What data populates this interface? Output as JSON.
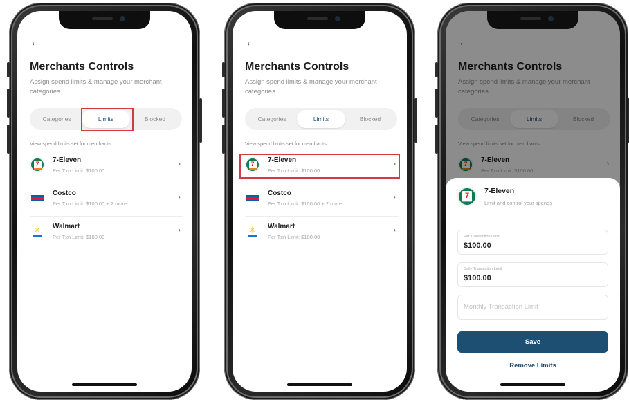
{
  "screens": [
    {
      "title": "Merchants Controls",
      "subtitle": "Assign spend limits & manage your merchant categories",
      "tabs": [
        "Categories",
        "Limits",
        "Blocked"
      ],
      "active_tab": "Limits",
      "highlight": "Limits tab",
      "list_caption": "View spend limits set for merchants",
      "merchants": [
        {
          "name": "7-Eleven",
          "limit": "Per Txn Limit: $100.00",
          "logo": "7-eleven-logo"
        },
        {
          "name": "Costco",
          "limit": "Per Txn Limit: $100.00 + 2 more",
          "logo": "costco-logo"
        },
        {
          "name": "Walmart",
          "limit": "Per Txn Limit: $100.00",
          "logo": "walmart-logo"
        }
      ]
    },
    {
      "title": "Merchants Controls",
      "subtitle": "Assign spend limits & manage your merchant categories",
      "tabs": [
        "Categories",
        "Limits",
        "Blocked"
      ],
      "active_tab": "Limits",
      "highlight": "7-Eleven row",
      "list_caption": "View spend limits set for merchants",
      "merchants": [
        {
          "name": "7-Eleven",
          "limit": "Per Txn Limit: $100.00",
          "logo": "7-eleven-logo"
        },
        {
          "name": "Costco",
          "limit": "Per Txn Limit: $100.00 + 2 more",
          "logo": "costco-logo"
        },
        {
          "name": "Walmart",
          "limit": "Per Txn Limit: $100.00",
          "logo": "walmart-logo"
        }
      ]
    },
    {
      "title": "Merchants Controls",
      "subtitle": "Assign spend limits & manage your merchant categories",
      "tabs": [
        "Categories",
        "Limits",
        "Blocked"
      ],
      "active_tab": "Limits",
      "list_caption": "View spend limits set for merchants",
      "merchants": [
        {
          "name": "7-Eleven",
          "limit": "Per Txn Limit: $100.00",
          "logo": "7-eleven-logo"
        }
      ],
      "sheet": {
        "merchant": "7-Eleven",
        "subtitle": "Limit and control your spends",
        "fields": [
          {
            "label": "Per Transaction Limit",
            "value": "$100.00"
          },
          {
            "label": "Daily Transaction Limit",
            "value": "$100.00"
          },
          {
            "label": "",
            "placeholder": "Monthly Transaction Limit",
            "value": ""
          }
        ],
        "save_label": "Save",
        "remove_label": "Remove Limits"
      }
    }
  ],
  "icons": {
    "back": "←",
    "chevron": "›",
    "seven": "7"
  },
  "colors": {
    "accent": "#1d4f73",
    "highlight": "#d33a45",
    "seven_green": "#117a55"
  }
}
